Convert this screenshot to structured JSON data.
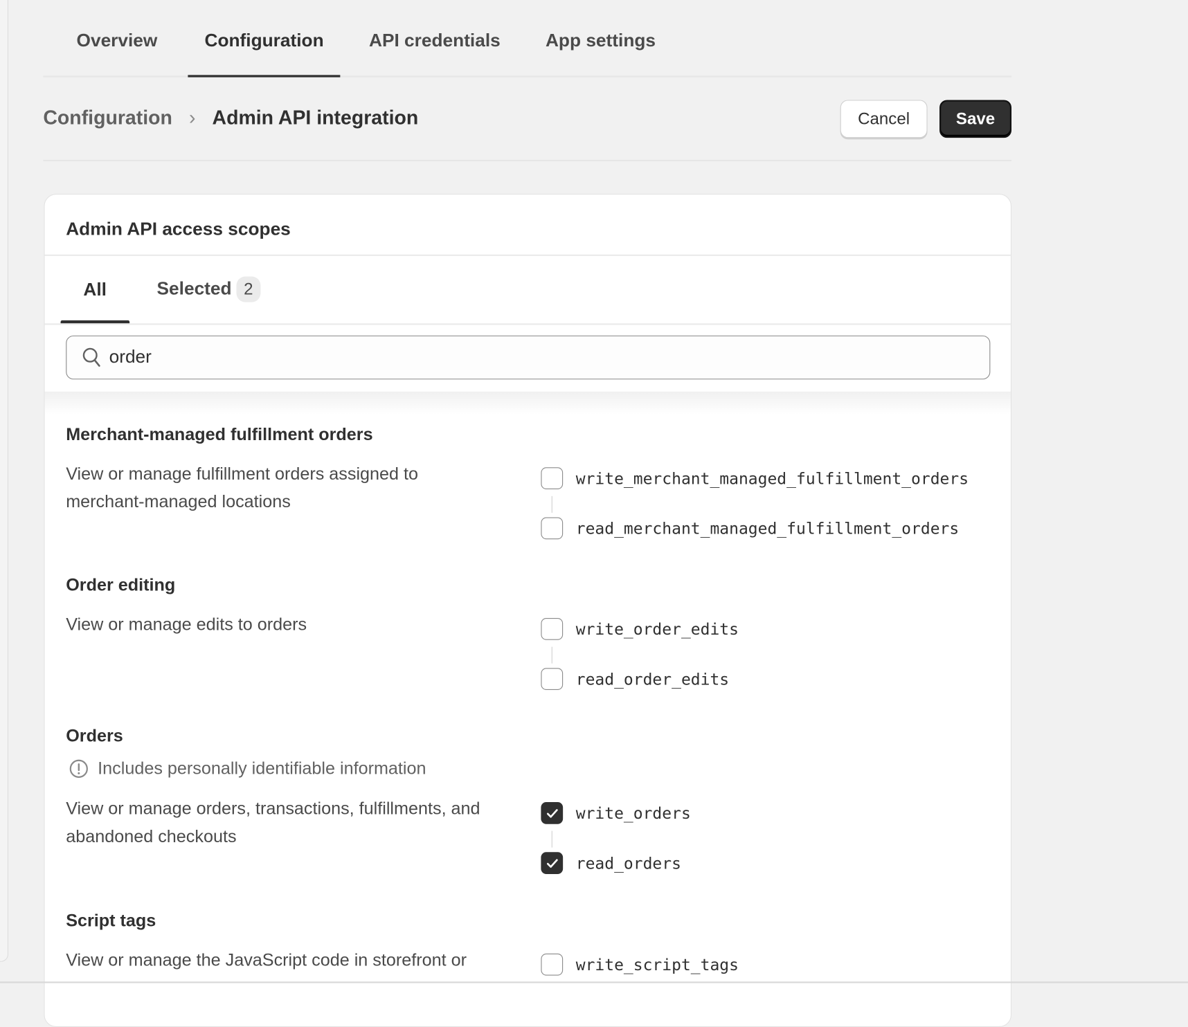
{
  "tabs": [
    "Overview",
    "Configuration",
    "API credentials",
    "App settings"
  ],
  "active_tab": "Configuration",
  "breadcrumb": {
    "parent": "Configuration",
    "current": "Admin API integration"
  },
  "actions": {
    "cancel": "Cancel",
    "save": "Save"
  },
  "card": {
    "title": "Admin API access scopes",
    "filter_tabs": {
      "all": "All",
      "selected": "Selected",
      "selected_count": "2"
    },
    "search": {
      "value": "order"
    },
    "sections": [
      {
        "title": "Merchant-managed fulfillment orders",
        "description": "View or manage fulfillment orders assigned to merchant-managed locations",
        "scopes": [
          {
            "name": "write_merchant_managed_fulfillment_orders",
            "checked": false
          },
          {
            "name": "read_merchant_managed_fulfillment_orders",
            "checked": false
          }
        ]
      },
      {
        "title": "Order editing",
        "description": "View or manage edits to orders",
        "scopes": [
          {
            "name": "write_order_edits",
            "checked": false
          },
          {
            "name": "read_order_edits",
            "checked": false
          }
        ]
      },
      {
        "title": "Orders",
        "notice": "Includes personally identifiable information",
        "description": "View or manage orders, transactions, fulfillments, and abandoned checkouts",
        "scopes": [
          {
            "name": "write_orders",
            "checked": true
          },
          {
            "name": "read_orders",
            "checked": true
          }
        ]
      },
      {
        "title": "Script tags",
        "description": "View or manage the JavaScript code in storefront or",
        "scopes": [
          {
            "name": "write_script_tags",
            "checked": false
          }
        ]
      }
    ]
  },
  "colors": {
    "primary_button": "#303030",
    "background": "#f1f1f1",
    "checked": "#303030"
  }
}
